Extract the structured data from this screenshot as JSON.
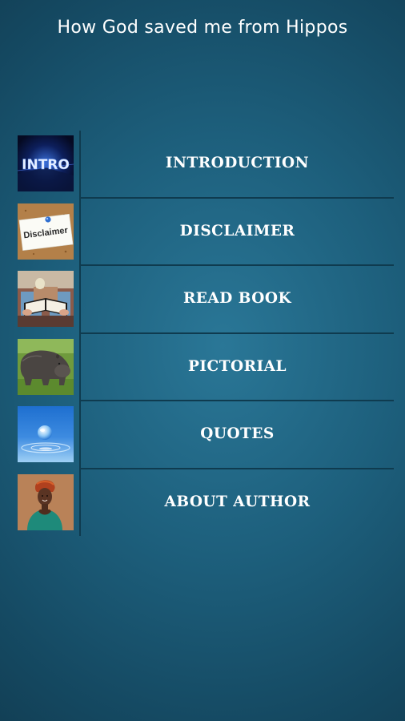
{
  "app": {
    "title": "How God saved me from Hippos"
  },
  "menu": {
    "items": [
      {
        "label": "INTRODUCTION",
        "icon": "intro-image"
      },
      {
        "label": "DISCLAIMER",
        "icon": "disclaimer-note-image",
        "thumb_text": "Disclaimer"
      },
      {
        "label": "READ BOOK",
        "icon": "person-reading-image"
      },
      {
        "label": "PICTORIAL",
        "icon": "hippo-image"
      },
      {
        "label": "QUOTES",
        "icon": "water-drop-image"
      },
      {
        "label": "ABOUT AUTHOR",
        "icon": "author-portrait-image"
      }
    ]
  },
  "colors": {
    "background": "#1d5f7c",
    "divider": "#0f3b4f",
    "text": "#ffffff"
  }
}
